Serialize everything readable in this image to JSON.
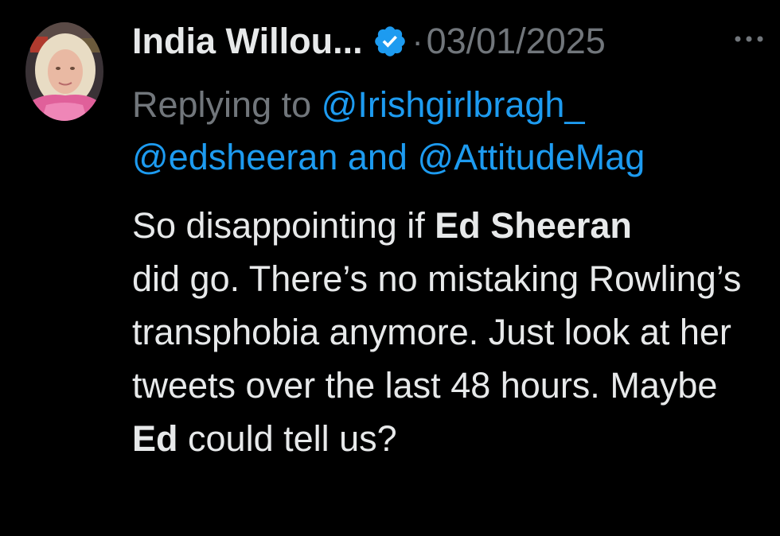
{
  "tweet": {
    "author_name": "India Willou...",
    "separator": "·",
    "date": "03/01/2025",
    "replying": {
      "prefix": "Replying to",
      "mention_1": "@Irishgirlbragh_",
      "mention_2": "@edsheeran",
      "conjunction": "and",
      "mention_3": "@AttitudeMag"
    },
    "text": {
      "p1": "So disappointing if",
      "b1": "Ed Sheeran",
      "p2": "did go. There’s no mistaking Rowling’s transphobia anymore. Just look at her tweets over the last 48 hours. Maybe",
      "b2": "Ed",
      "p3": "could tell us?"
    }
  },
  "icons": {
    "avatar": "avatar-photo",
    "verified": "verified-badge-icon",
    "more": "more-options-icon"
  },
  "colors": {
    "background": "#000000",
    "text": "#e7e9ea",
    "secondary": "#71767b",
    "link": "#1d9bf0"
  }
}
